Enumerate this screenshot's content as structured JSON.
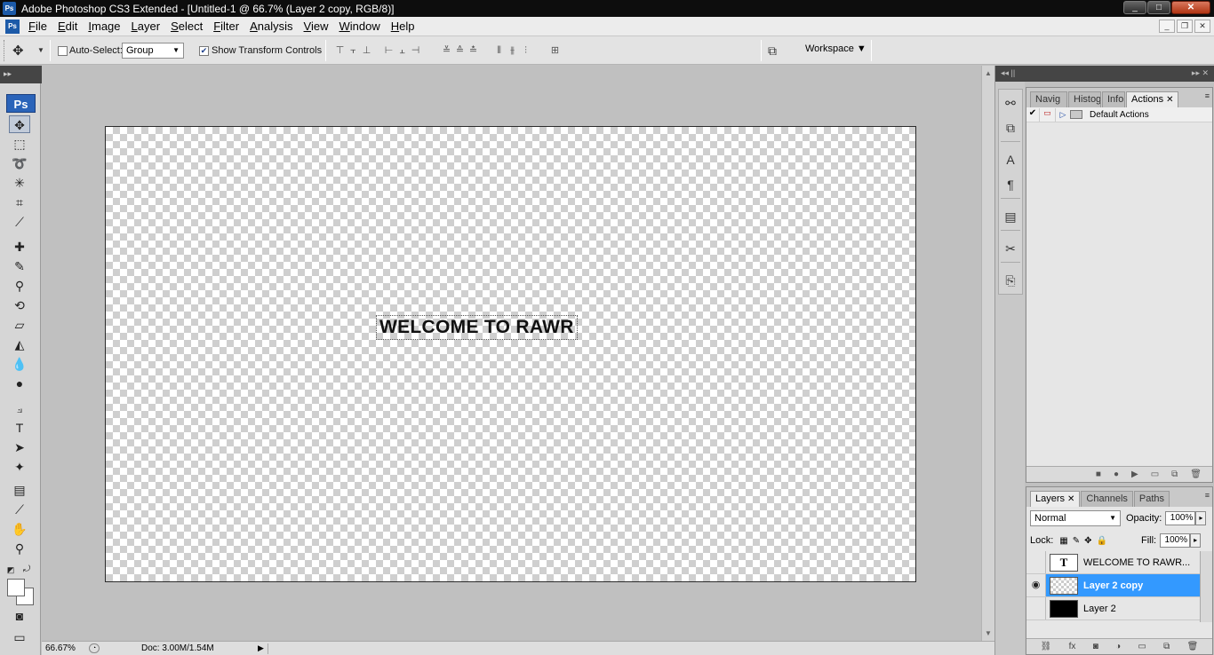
{
  "window": {
    "title": "Adobe Photoshop CS3 Extended - [Untitled-1 @ 66.7% (Layer 2 copy, RGB/8)]",
    "app_icon": "Ps",
    "minimize": "_",
    "maximize": "□",
    "close": "✕"
  },
  "menu": {
    "items": [
      "File",
      "Edit",
      "Image",
      "Layer",
      "Select",
      "Filter",
      "Analysis",
      "View",
      "Window",
      "Help"
    ],
    "doc_min": "_",
    "doc_restore": "❐",
    "doc_close": "✕"
  },
  "options": {
    "auto_select_label": "Auto-Select:",
    "auto_select_checked": false,
    "group_value": "Group",
    "show_transform_label": "Show Transform Controls",
    "show_transform_checked": true,
    "workspace_label": "Workspace ▼"
  },
  "tools": {
    "badge": "Ps",
    "grip": "▸▸",
    "active": "move-tool"
  },
  "canvas": {
    "text": "WELCOME TO RAWR",
    "background": "transparent-checker"
  },
  "status": {
    "zoom": "66.67%",
    "doc": "Doc: 3.00M/1.54M",
    "arrow": "▶"
  },
  "dock": {
    "header": "◂◂ ||"
  },
  "right_panel_header": "▸▸ ✕",
  "actions_panel": {
    "tabs": [
      {
        "label": "Navig"
      },
      {
        "label": "Histog"
      },
      {
        "label": "Info"
      },
      {
        "label": "Actions"
      }
    ],
    "active_tab": "Actions",
    "tab_close": "✕",
    "menu_btn": "≡",
    "rows": [
      {
        "check": "✔",
        "name": "Default Actions"
      }
    ]
  },
  "layers_panel": {
    "tabs": [
      {
        "label": "Layers"
      },
      {
        "label": "Channels"
      },
      {
        "label": "Paths"
      }
    ],
    "active_tab": "Layers",
    "tab_close": "✕",
    "menu_btn": "≡",
    "blend_mode": "Normal",
    "opacity_label": "Opacity:",
    "opacity": "100%",
    "lock_label": "Lock:",
    "fill_label": "Fill:",
    "fill": "100%",
    "text_thumb": "T",
    "layers": [
      {
        "name": "WELCOME TO RAWR...",
        "visible": false,
        "type": "text"
      },
      {
        "name": "Layer 2 copy",
        "visible": true,
        "type": "transparent",
        "selected": true
      },
      {
        "name": "Layer 2",
        "visible": false,
        "type": "black"
      }
    ],
    "eye_glyph": "👁"
  },
  "colors": {
    "title_bar": "#0d0d0d",
    "selected_layer": "#3399ff",
    "canvas_bg": "#c0c0c0"
  }
}
